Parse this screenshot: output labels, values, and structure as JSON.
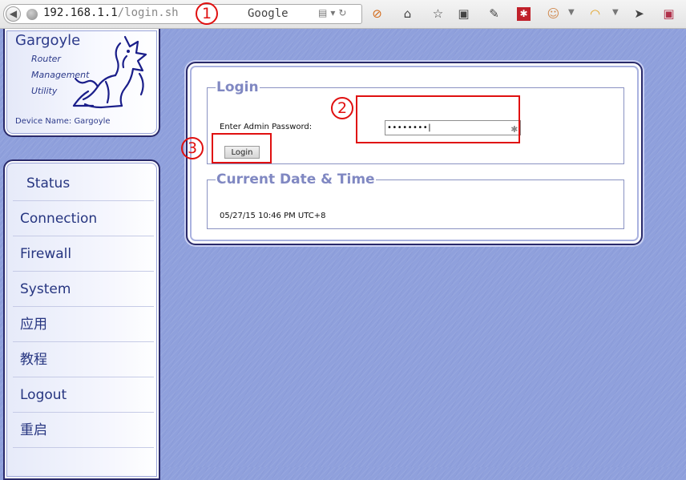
{
  "browser": {
    "url_host": "192.168.1.1",
    "url_path": "/login.sh",
    "search_engine": "Google",
    "toolbar_icons": [
      "back-icon",
      "site-identity-icon",
      "rss-feed-icon",
      "dropdown-icon",
      "reload-icon",
      "adblock-icon",
      "home-icon",
      "bookmark-star-icon",
      "bookmarks-list-icon",
      "tools-wrench-icon",
      "addon-red-icon",
      "face-icon",
      "rainbow-icon",
      "send-icon",
      "window-icon"
    ]
  },
  "header": {
    "title": "Gargoyle",
    "subtitle_lines": [
      "Router",
      "Management",
      "Utility"
    ],
    "device_name_label": "Device Name:",
    "device_name": "Gargoyle"
  },
  "nav": {
    "items": [
      {
        "label": "Status",
        "active": true
      },
      {
        "label": "Connection"
      },
      {
        "label": "Firewall"
      },
      {
        "label": "System"
      },
      {
        "label": "应用"
      },
      {
        "label": "教程"
      },
      {
        "label": "Logout"
      },
      {
        "label": "重启"
      }
    ]
  },
  "login": {
    "legend": "Login",
    "password_label": "Enter Admin Password:",
    "password_value": "••••••••",
    "button_label": "Login"
  },
  "datetime": {
    "legend": "Current Date & Time",
    "value": "05/27/15 10:46 PM UTC+8"
  },
  "annotations": {
    "step1": "1",
    "step2": "2",
    "step3": "3",
    "color": "#e01010"
  },
  "colors": {
    "background": "#8fa0dc",
    "nav_text": "#263580",
    "legend": "#8088c2"
  }
}
